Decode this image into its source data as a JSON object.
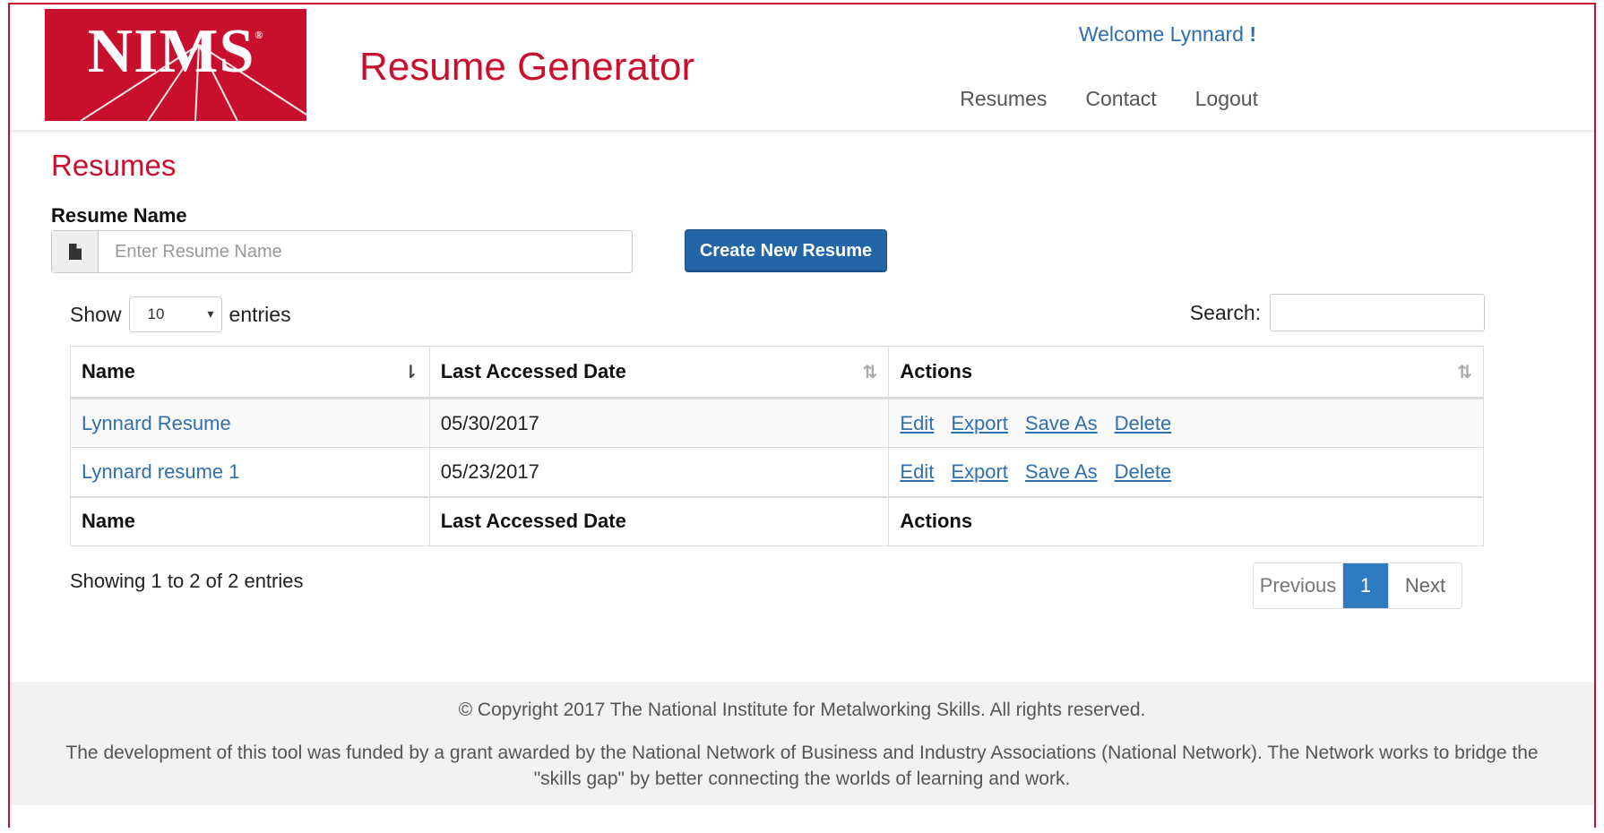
{
  "header": {
    "logo_text": "NIMS",
    "logo_mark": "®",
    "app_title": "Resume Generator",
    "welcome_prefix": "Welcome Lynnard",
    "welcome_suffix": "!",
    "nav": [
      "Resumes",
      "Contact",
      "Logout"
    ]
  },
  "main": {
    "page_title": "Resumes",
    "resume_name_label": "Resume Name",
    "resume_name_placeholder": "Enter Resume Name",
    "create_button": "Create New Resume",
    "show_label": "Show",
    "entries_label": "entries",
    "page_size": "10",
    "search_label": "Search:",
    "search_value": ""
  },
  "table": {
    "columns": [
      "Name",
      "Last Accessed Date",
      "Actions"
    ],
    "rows": [
      {
        "name": "Lynnard Resume",
        "date": "05/30/2017"
      },
      {
        "name": "Lynnard resume 1",
        "date": "05/23/2017"
      }
    ],
    "actions": [
      "Edit",
      "Export",
      "Save As",
      "Delete"
    ],
    "info": "Showing 1 to 2 of 2 entries",
    "pager": {
      "previous": "Previous",
      "current": "1",
      "next": "Next"
    }
  },
  "footer": {
    "copyright": "© Copyright 2017 The National Institute for Metalworking Skills. All rights reserved.",
    "grant": "The development of this tool was funded by a grant awarded by the National Network of Business and Industry Associations (National Network). The Network works to bridge the \"skills gap\" by better connecting the worlds of learning and work."
  },
  "colors": {
    "brand_red": "#c8102e",
    "link_blue": "#2f6fb0",
    "button_blue": "#2366a8"
  }
}
